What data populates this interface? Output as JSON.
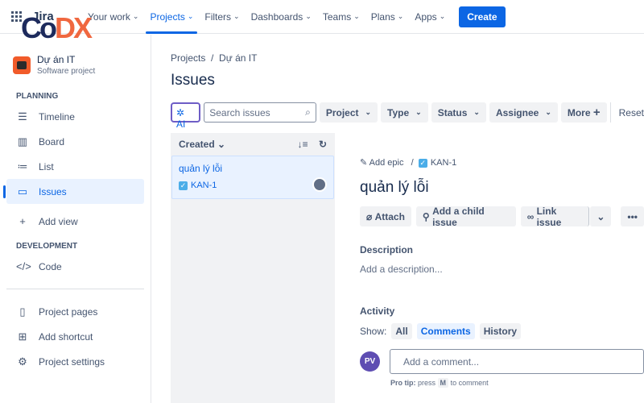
{
  "topbar": {
    "product": "Jira",
    "nav": [
      {
        "label": "Your work"
      },
      {
        "label": "Projects",
        "active": true
      },
      {
        "label": "Filters"
      },
      {
        "label": "Dashboards"
      },
      {
        "label": "Teams"
      },
      {
        "label": "Plans"
      },
      {
        "label": "Apps"
      }
    ],
    "create": "Create"
  },
  "watermark": {
    "text_a": "Co",
    "text_b": "DX"
  },
  "sidebar": {
    "project_name": "Dự án IT",
    "project_type": "Software project",
    "planning": "PLANNING",
    "items": [
      {
        "label": "Timeline",
        "icon": "timeline-icon"
      },
      {
        "label": "Board",
        "icon": "board-icon"
      },
      {
        "label": "List",
        "icon": "list-icon"
      },
      {
        "label": "Issues",
        "icon": "issues-icon",
        "active": true
      },
      {
        "label": "Add view",
        "icon": "plus-icon"
      }
    ],
    "development": "DEVELOPMENT",
    "dev_items": [
      {
        "label": "Code",
        "icon": "code-icon"
      }
    ],
    "bottom": [
      {
        "label": "Project pages"
      },
      {
        "label": "Add shortcut"
      },
      {
        "label": "Project settings"
      }
    ]
  },
  "main": {
    "breadcrumb": [
      "Projects",
      "Dự án IT"
    ],
    "title": "Issues",
    "filters": {
      "ai": "AI",
      "search_placeholder": "Search issues",
      "buttons": [
        "Project",
        "Type",
        "Status",
        "Assignee"
      ],
      "more": "More",
      "reset": "Reset"
    },
    "list": {
      "sort": "Created",
      "issues": [
        {
          "title": "quản lý lỗi",
          "key": "KAN-1"
        }
      ]
    },
    "detail": {
      "add_epic": "Add epic",
      "key": "KAN-1",
      "title": "quản lý lỗi",
      "actions": [
        "Attach",
        "Add a child issue",
        "Link issue"
      ],
      "description_label": "Description",
      "description_placeholder": "Add a description...",
      "activity_label": "Activity",
      "show_label": "Show:",
      "tabs": [
        "All",
        "Comments",
        "History"
      ],
      "active_tab": "Comments",
      "avatar": "PV",
      "comment_placeholder": "Add a comment...",
      "tip_bold": "Pro tip:",
      "tip_a": "press",
      "tip_key": "M",
      "tip_b": "to comment"
    }
  }
}
